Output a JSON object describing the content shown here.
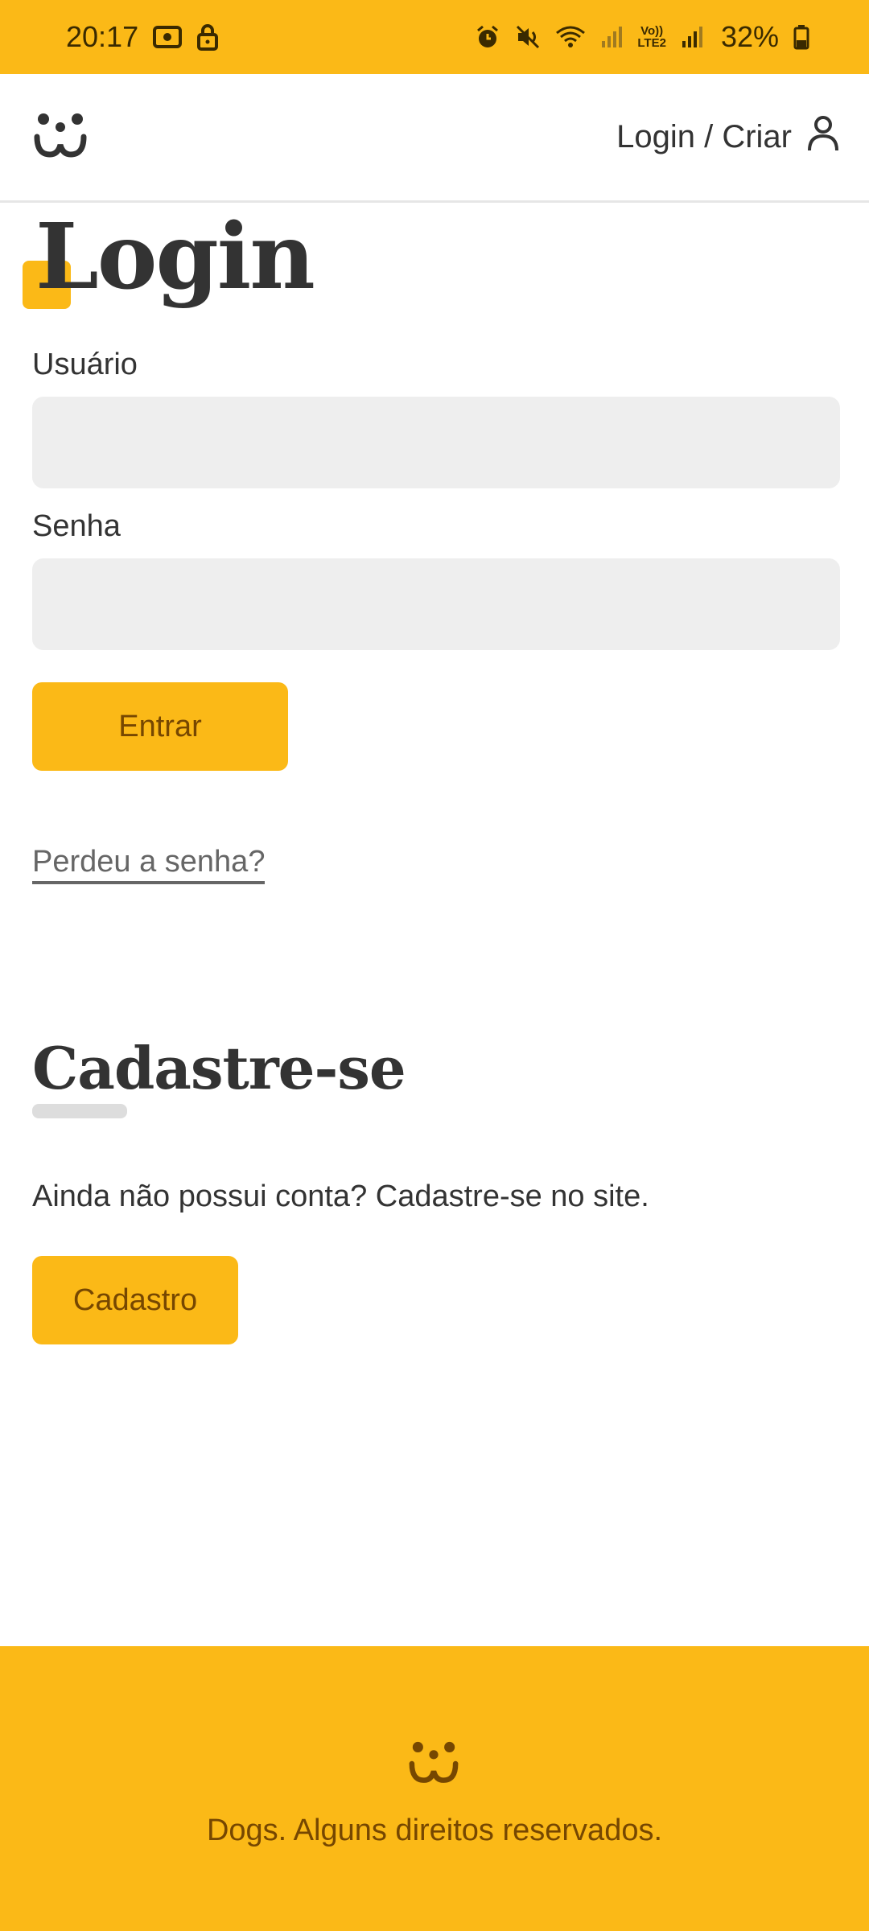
{
  "status_bar": {
    "time": "20:17",
    "battery": "32%",
    "lte_label_top": "Vo))",
    "lte_label_bottom": "LTE2",
    "icons": [
      "screen-record-icon",
      "lock-icon",
      "alarm-icon",
      "mute-icon",
      "wifi-icon",
      "signal-icon",
      "volte-icon",
      "signal-icon",
      "battery-icon"
    ]
  },
  "header": {
    "logo_icon": "dog-logo-icon",
    "account_label": "Login / Criar",
    "account_icon": "user-icon"
  },
  "login": {
    "title": "Login",
    "username_label": "Usuário",
    "username_value": "",
    "password_label": "Senha",
    "password_value": "",
    "submit_label": "Entrar",
    "lost_password_link": "Perdeu a senha?"
  },
  "register": {
    "title": "Cadastre-se",
    "text": "Ainda não possui conta? Cadastre-se no site.",
    "button_label": "Cadastro"
  },
  "footer": {
    "logo_icon": "dog-logo-icon",
    "text": "Dogs. Alguns direitos reservados."
  },
  "colors": {
    "brand_yellow": "#FBB917",
    "brand_brown": "#764701",
    "text_dark": "#333333",
    "input_bg": "#EEEEEE",
    "link_gray": "#666666"
  }
}
